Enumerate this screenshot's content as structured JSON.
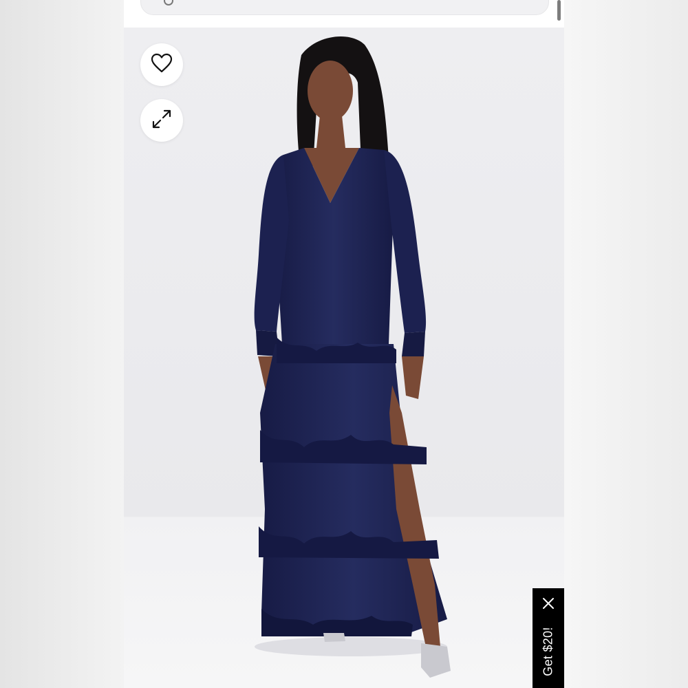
{
  "header": {
    "search_icon": "search-icon"
  },
  "product_image": {
    "alt_subject": "navy-blue-long-sleeve-tiered-ruffle-maxi-dress",
    "colors": {
      "dress": "#1e2452",
      "background": "#ececef"
    }
  },
  "actions": {
    "favorite_icon": "heart-icon",
    "expand_icon": "expand-arrows-icon"
  },
  "promo": {
    "label": "Get $20!",
    "close_icon": "close-icon",
    "background": "#000000",
    "text_color": "#ffffff"
  }
}
